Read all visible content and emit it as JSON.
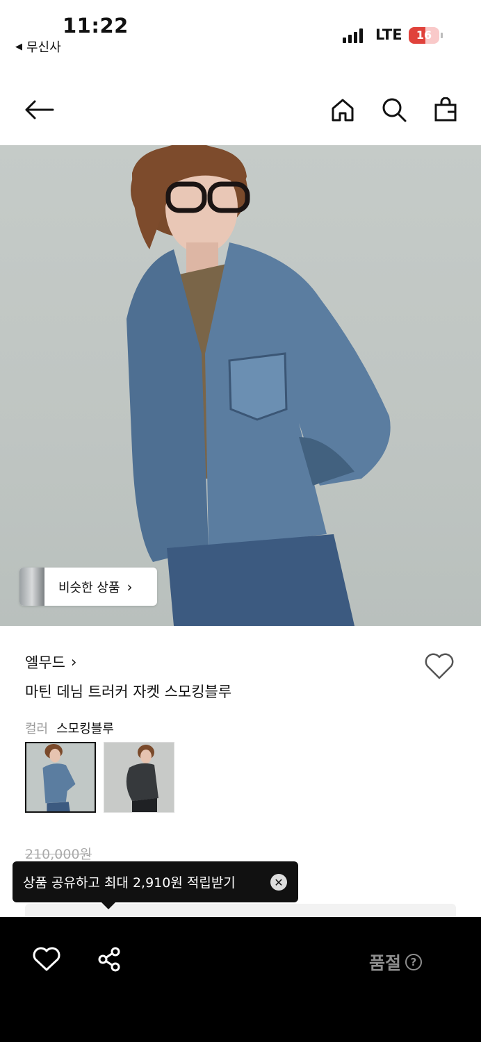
{
  "status": {
    "time": "11:22",
    "back_app": "무신사",
    "network": "LTE",
    "battery": "16"
  },
  "product": {
    "similar_label": "비슷한 상품",
    "brand": "엘무드",
    "name": "마틴 데님 트러커 자켓 스모킹블루",
    "color_key": "컬러",
    "color_value": "스모킹블루",
    "price_original": "210,000원"
  },
  "tooltip": {
    "text": "상품 공유하고 최대 2,910원 적립받기"
  },
  "bottom": {
    "soldout": "품절",
    "help": "?"
  },
  "colors": {
    "accent": "#111111",
    "battery_red": "#e0423b",
    "muted": "#8e8e8e"
  }
}
